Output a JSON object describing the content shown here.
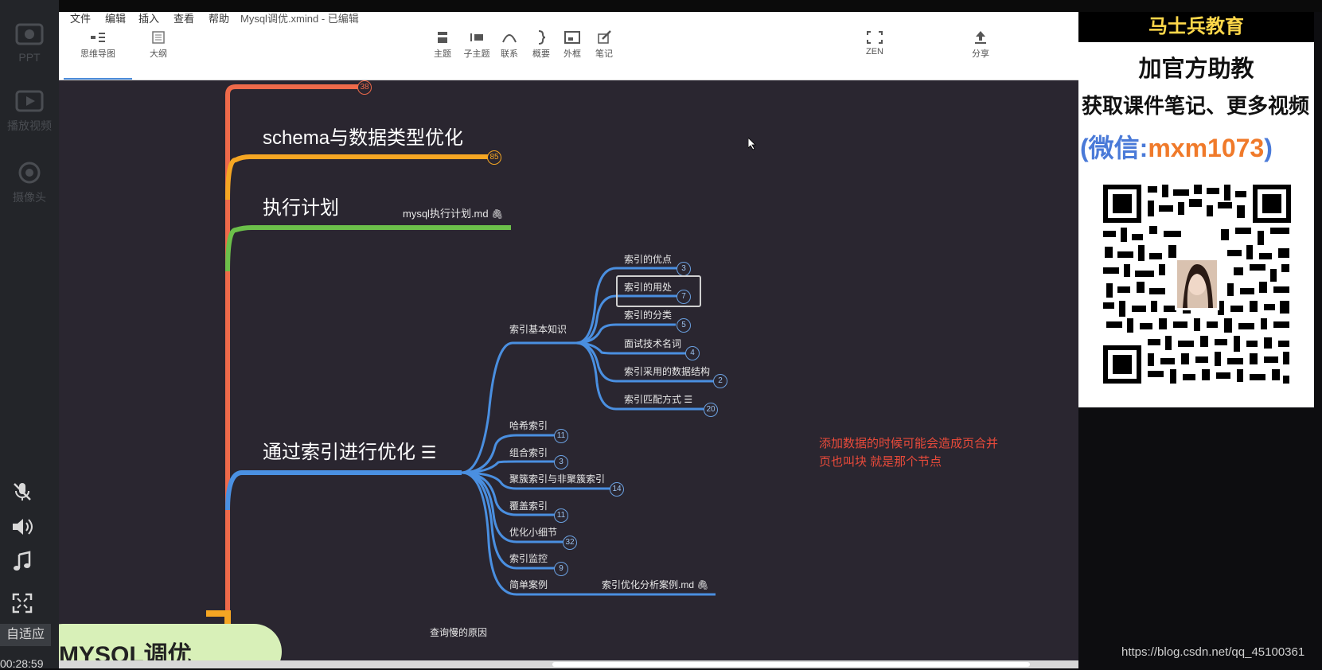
{
  "left_panel": {
    "buttons": [
      {
        "icon": "ppt-icon",
        "label": "PPT"
      },
      {
        "icon": "play-video-icon",
        "label": "播放视频"
      },
      {
        "icon": "camera-icon",
        "label": "摄像头"
      }
    ],
    "controls": [
      "mic-muted-icon",
      "volume-icon",
      "music-note-icon",
      "fullscreen-icon"
    ],
    "adapt_label": "自适应",
    "timer": "00:28:59"
  },
  "menu": {
    "items": [
      "文件",
      "编辑",
      "插入",
      "查看",
      "帮助"
    ],
    "doc_title": "Mysql调优.xmind - 已编辑"
  },
  "toolbar": {
    "tabs": [
      {
        "icon": "mindmap-icon",
        "label": "思维导图",
        "active": true
      },
      {
        "icon": "outline-icon",
        "label": "大纲",
        "active": false
      }
    ],
    "tools": [
      {
        "icon": "topic-icon",
        "label": "主题"
      },
      {
        "icon": "subtopic-icon",
        "label": "子主题"
      },
      {
        "icon": "relationship-icon",
        "label": "联系"
      },
      {
        "icon": "summary-icon",
        "label": "概要"
      },
      {
        "icon": "boundary-icon",
        "label": "外框"
      },
      {
        "icon": "note-icon",
        "label": "笔记"
      }
    ],
    "zen": {
      "icon": "zen-icon",
      "label": "ZEN"
    },
    "share": {
      "icon": "share-icon",
      "label": "分享"
    }
  },
  "mindmap": {
    "root": "MYSQL调优",
    "topic_1_badge": "38",
    "topics": [
      {
        "title": "schema与数据类型优化",
        "badge": "85"
      },
      {
        "title": "执行计划",
        "attachment": "mysql执行计划.md"
      },
      {
        "title": "通过索引进行优化",
        "has_note": true
      }
    ],
    "index_branch": {
      "basics": {
        "title": "索引基本知识",
        "children": [
          {
            "label": "索引的优点",
            "badge": "3"
          },
          {
            "label": "索引的用处",
            "badge": "7",
            "selected": true
          },
          {
            "label": "索引的分类",
            "badge": "5"
          },
          {
            "label": "面试技术名词",
            "badge": "4"
          },
          {
            "label": "索引采用的数据结构",
            "badge": "2"
          },
          {
            "label": "索引匹配方式",
            "badge": "20",
            "has_note": true
          }
        ]
      },
      "others": [
        {
          "label": "哈希索引",
          "badge": "11"
        },
        {
          "label": "组合索引",
          "badge": "3"
        },
        {
          "label": "聚簇索引与非聚簇索引",
          "badge": "14"
        },
        {
          "label": "覆盖索引",
          "badge": "11"
        },
        {
          "label": "优化小细节",
          "badge": "32"
        },
        {
          "label": "索引监控",
          "badge": "9"
        },
        {
          "label": "简单案例",
          "attachment": "索引优化分析案例.md"
        }
      ]
    },
    "partial_bottom_label": "查询慢的原因",
    "floating_note": [
      "添加数据的时候可能会造成页合并",
      "页也叫块 就是那个节点"
    ],
    "colors": {
      "orange_red": "#ef6a4a",
      "orange": "#f5a623",
      "green": "#6cc04a",
      "blue": "#4a90e2",
      "root_bg": "#d8f0b8",
      "note": "#e84a3a"
    }
  },
  "promo": {
    "header": "马士兵教育",
    "line1": "加官方助教",
    "line2": "获取课件笔记、更多视频",
    "line3_prefix": "(微信:",
    "line3_id": "mxm1073",
    "line3_suffix": ")",
    "qr_icon": "qr-code-icon"
  },
  "watermark": "https://blog.csdn.net/qq_45100361"
}
